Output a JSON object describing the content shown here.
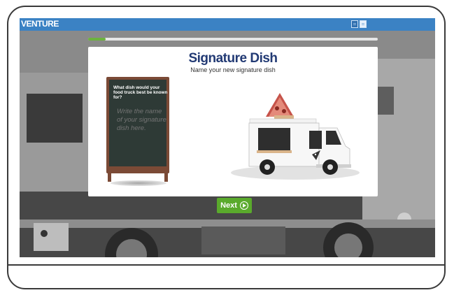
{
  "app": {
    "brand": "VENTURE"
  },
  "header": {
    "view_icons": [
      "grid-view-icon",
      "list-view-icon"
    ]
  },
  "progress": {
    "value": 0.06
  },
  "card": {
    "title": "Signature Dish",
    "subtitle": "Name your new signature dish"
  },
  "chalkboard": {
    "question": "What dish would your food truck best be known for?",
    "placeholder": "Write the name of your signature dish here."
  },
  "buttons": {
    "next_label": "Next"
  },
  "colors": {
    "topbar": "#3b82c4",
    "title": "#223a74",
    "next_button": "#5aaa2c",
    "progress_fill": "#6cb33e"
  }
}
